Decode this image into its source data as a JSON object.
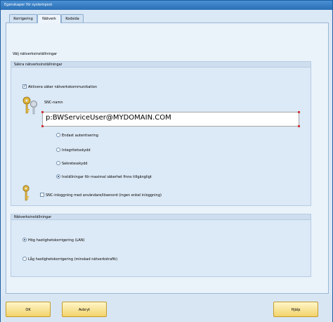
{
  "window": {
    "title": "Egenskaper för systempost"
  },
  "tabs": [
    {
      "label": "Korrigering"
    },
    {
      "label": "Nätverk"
    },
    {
      "label": "Kodsida"
    }
  ],
  "prompt": "Välj nätverksinställningar",
  "secure_group": {
    "title": "Säkra nätverksinställningar",
    "enable_snc_label": "Aktivera säker nätverkskommunikation",
    "enable_snc_checked": true,
    "snc_name_label": "SNC-namn",
    "snc_name_value": "p:BWServiceUser@MYDOMAIN.COM",
    "options": [
      {
        "label": "Endast autentisering",
        "checked": false
      },
      {
        "label": "Integritetsskydd",
        "checked": false
      },
      {
        "label": "Sekretesskydd",
        "checked": false
      },
      {
        "label": "Inställningar för maximal säkerhet finns tillgängligt",
        "checked": true
      }
    ],
    "snc_logon_label": "SNC-inloggning med användare/lösenord (ingen enkel inloggning)",
    "snc_logon_checked": false
  },
  "network_group": {
    "title": "Nätverksinställningar",
    "options": [
      {
        "label": "Hög hastighetskorrigering (LAN)",
        "checked": true
      },
      {
        "label": "Låg hastighetskorrigering (minskad nätverkstrafik)",
        "checked": false
      }
    ]
  },
  "buttons": {
    "ok": "OK",
    "cancel": "Avbryt",
    "help": "Hjälp"
  },
  "colors": {
    "accent": "#2a6fb5",
    "button": "#f2d36c"
  }
}
